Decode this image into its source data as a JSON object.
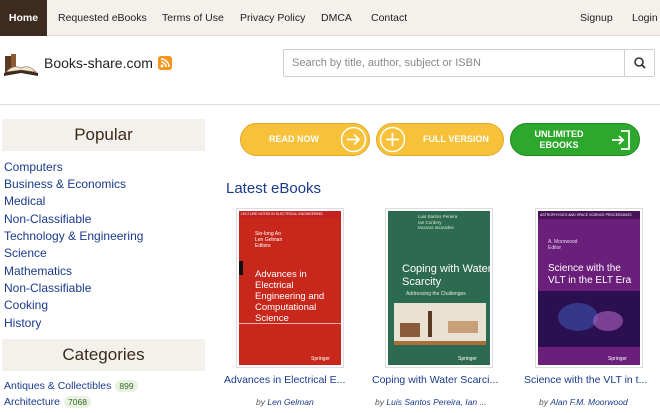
{
  "nav": {
    "home": "Home",
    "requested": "Requested eBooks",
    "terms": "Terms of Use",
    "privacy": "Privacy Policy",
    "dmca": "DMCA",
    "contact": "Contact",
    "signup": "Signup",
    "login": "Login"
  },
  "header": {
    "logo_text": "Books-share.com",
    "search_placeholder": "Search by title, author, subject or ISBN"
  },
  "sidebar": {
    "popular_title": "Popular",
    "popular": [
      "Computers",
      "Business & Economics",
      "Medical",
      "Non-Classifiable",
      "Technology & Engineering",
      "Science",
      "Mathematics",
      "Non-Classifiable",
      "Cooking",
      "History"
    ],
    "categories_title": "Categories",
    "categories": [
      {
        "name": "Antiques & Collectibles",
        "count": "899"
      },
      {
        "name": "Architecture",
        "count": "7068"
      }
    ]
  },
  "buttons": {
    "read_now": "READ NOW",
    "full_version": "FULL VERSION",
    "unlimited_line1": "UNLIMITED",
    "unlimited_line2": "EBOOKS"
  },
  "latest": {
    "title": "Latest eBooks",
    "by": "by",
    "books": [
      {
        "title": "Advances in Electrical E...",
        "author": "Len Gelman",
        "cover_series": "LECTURE NOTES IN ELECTRICAL ENGINEERING",
        "cover_editors": "Sio-Iong Ao\nLen Gelman\nEditors",
        "cover_title": "Advances in Electrical Engineering and Computational Science",
        "cover_publisher": "Springer"
      },
      {
        "title": "Coping with Water Scarci...",
        "author": "Luis Santos Pereira, Ian ...",
        "cover_editors": "Luis Santos Pereira\nIan Cordery\nIacovos Iacovides",
        "cover_title": "Coping with Water Scarcity",
        "cover_subtitle": "Addressing the Challenges",
        "cover_publisher": "Springer"
      },
      {
        "title": "Science with the VLT in t...",
        "author": "Alan F.M. Moorwood",
        "cover_series": "ASTROPHYSICS AND SPACE SCIENCE PROCEEDINGS",
        "cover_editors": "A. Moorwood\nEditor",
        "cover_title": "Science with the VLT in the ELT Era",
        "cover_publisher": "Springer"
      }
    ]
  }
}
